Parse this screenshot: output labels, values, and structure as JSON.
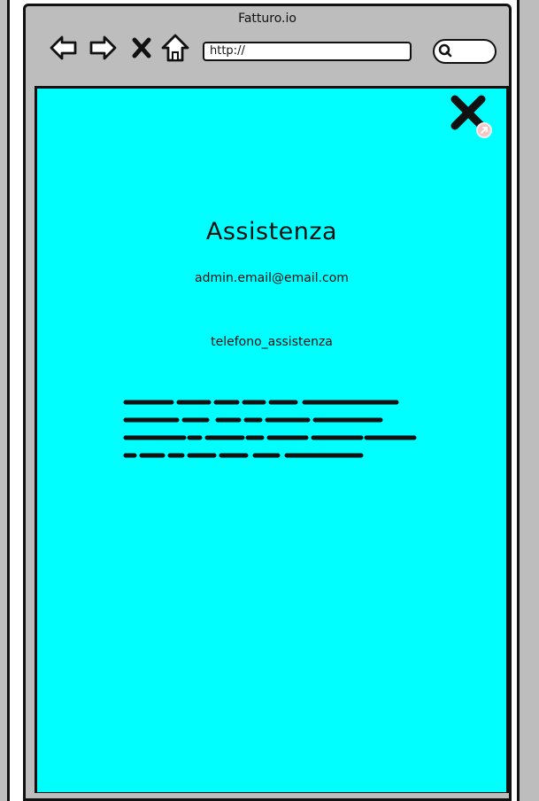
{
  "window": {
    "title": "Fatturo.io"
  },
  "toolbar": {
    "back_icon": "arrow-left-icon",
    "forward_icon": "arrow-right-icon",
    "stop_icon": "close-icon",
    "home_icon": "home-icon",
    "search_icon": "search-icon"
  },
  "address_bar": {
    "value": "http://"
  },
  "page": {
    "background": "#00ffff",
    "close_icon": "close-x-icon",
    "heading": "Assistenza",
    "email": "admin.email@email.com",
    "phone": "telefono_assistenza",
    "body_text_placeholder": "scribbled lorem text"
  }
}
